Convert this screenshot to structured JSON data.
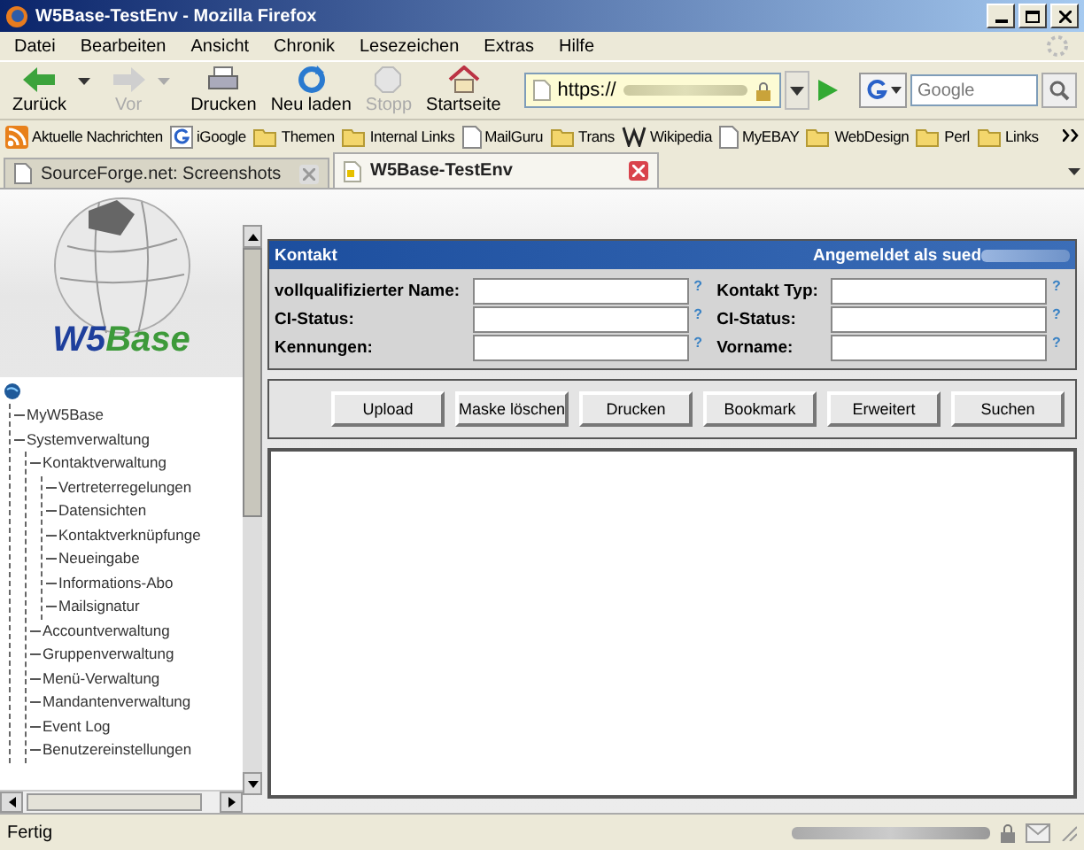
{
  "window": {
    "title": "W5Base-TestEnv - Mozilla Firefox"
  },
  "menu": [
    "Datei",
    "Bearbeiten",
    "Ansicht",
    "Chronik",
    "Lesezeichen",
    "Extras",
    "Hilfe"
  ],
  "toolbar": [
    {
      "kind": "back",
      "label": "Zurück",
      "disabled": false,
      "dropdown": true
    },
    {
      "kind": "forward",
      "label": "Vor",
      "disabled": true,
      "dropdown": true
    },
    {
      "kind": "print",
      "label": "Drucken",
      "disabled": false,
      "dropdown": false
    },
    {
      "kind": "reload",
      "label": "Neu laden",
      "disabled": false,
      "dropdown": false
    },
    {
      "kind": "stop",
      "label": "Stopp",
      "disabled": true,
      "dropdown": false
    },
    {
      "kind": "home",
      "label": "Startseite",
      "disabled": false,
      "dropdown": false
    }
  ],
  "address": {
    "value": "https://"
  },
  "search": {
    "placeholder": "Google"
  },
  "bookmarks": [
    {
      "kind": "rss",
      "label": "Aktuelle Nachrichten"
    },
    {
      "kind": "g",
      "label": "iGoogle"
    },
    {
      "kind": "folder",
      "label": "Themen"
    },
    {
      "kind": "folder",
      "label": "Internal Links"
    },
    {
      "kind": "page",
      "label": "MailGuru"
    },
    {
      "kind": "folder",
      "label": "Trans"
    },
    {
      "kind": "w",
      "label": "Wikipedia"
    },
    {
      "kind": "page",
      "label": "MyEBAY"
    },
    {
      "kind": "folder",
      "label": "WebDesign"
    },
    {
      "kind": "folder",
      "label": "Perl"
    },
    {
      "kind": "folder",
      "label": "Links"
    }
  ],
  "tabs": [
    {
      "label": "SourceForge.net: Screenshots",
      "selected": false
    },
    {
      "label": "W5Base-TestEnv",
      "selected": true
    }
  ],
  "logo": {
    "prefix": "W5",
    "suffix": "Base"
  },
  "tree": [
    {
      "label": "MyW5Base"
    },
    {
      "label": "Systemverwaltung",
      "children": [
        {
          "label": "Kontaktverwaltung",
          "children": [
            {
              "label": "Vertreterregelungen"
            },
            {
              "label": "Datensichten"
            },
            {
              "label": "Kontaktverknüpfunge"
            },
            {
              "label": "Neueingabe"
            },
            {
              "label": "Informations-Abo"
            },
            {
              "label": "Mailsignatur"
            }
          ]
        },
        {
          "label": "Accountverwaltung"
        },
        {
          "label": "Gruppenverwaltung"
        },
        {
          "label": "Menü-Verwaltung"
        },
        {
          "label": "Mandantenverwaltung"
        },
        {
          "label": "Event Log"
        },
        {
          "label": "Benutzereinstellungen"
        }
      ]
    }
  ],
  "panel": {
    "title": "Kontakt",
    "user": "Angemeldet als sued"
  },
  "form": [
    [
      {
        "label": "vollqualifizierter Name:",
        "help": "?"
      },
      {
        "label": "Kontakt Typ:",
        "help": "?"
      }
    ],
    [
      {
        "label": "CI-Status:",
        "help": "?"
      },
      {
        "label": "CI-Status:",
        "help": "?"
      }
    ],
    [
      {
        "label": "Kennungen:",
        "help": "?"
      },
      {
        "label": "Vorname:",
        "help": "?"
      }
    ]
  ],
  "buttons": [
    "Upload",
    "Maske löschen",
    "Drucken",
    "Bookmark",
    "Erweitert",
    "Suchen"
  ],
  "status_bar": {
    "text": "Fertig"
  }
}
